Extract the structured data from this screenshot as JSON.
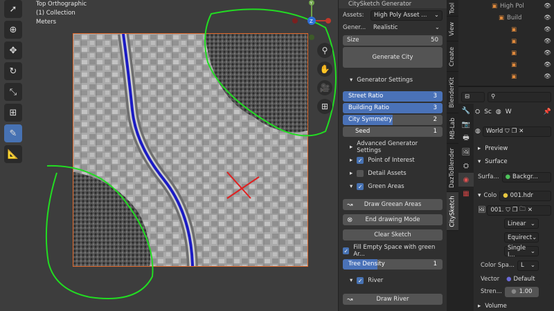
{
  "viewport": {
    "info": [
      "Top Orthographic",
      "(1) Collection",
      "Meters"
    ],
    "tools": [
      "select-box",
      "cursor",
      "move",
      "rotate",
      "scale",
      "transform",
      "annotate",
      "measure"
    ],
    "nav_tools": [
      "zoom",
      "pan",
      "camera",
      "grid"
    ]
  },
  "npanel": {
    "header": "CitySketch Generator",
    "assets_label": "Assets:",
    "assets_value": "High Poly Asset ...",
    "generator_label": "Gener...",
    "generator_value": "Realistic",
    "size_label": "Size",
    "size_value": "50",
    "generate_button": "Generate City",
    "generator_settings": "Generator Settings",
    "sliders": [
      {
        "label": "Street Ratio",
        "value": "3",
        "fill": 1.0
      },
      {
        "label": "Building Ratio",
        "value": "3",
        "fill": 1.0
      },
      {
        "label": "City Symmetry",
        "value": "2",
        "fill": 0.5
      },
      {
        "label": "Seed",
        "value": "1",
        "fill": 0.0
      }
    ],
    "advanced": "Advanced Generator Settings",
    "poi": "Point of Interest",
    "detail": "Detail Assets",
    "green": "Green Areas",
    "draw_green": "Draw Greean Areas",
    "end_drawing": "End drawing Mode",
    "clear_sketch": "Clear Sketch",
    "fill_empty": "Fill Empty Space with green Ar...",
    "tree_density_label": "Tree Density",
    "tree_density_value": "1",
    "river": "River",
    "draw_river": "Draw River"
  },
  "tabs": [
    "Tool",
    "View",
    "Create",
    "BlenderKit",
    "MB-Lab",
    "DazToBlender",
    "CitySketch"
  ],
  "outliner": {
    "rows": [
      "High Pol",
      "Build",
      "",
      "",
      "",
      "",
      ""
    ]
  },
  "props": {
    "search_placeholder": "",
    "scene_label": "Sc",
    "world_label": "W",
    "world_name": "World",
    "preview": "Preview",
    "surface": "Surface",
    "surface_label": "Surfa...",
    "surface_value": "Backgr...",
    "color_label": "Colo",
    "color_value": "001.hdr",
    "image_name": "001.",
    "linear": "Linear",
    "equirect": "Equirect",
    "single": "Single I...",
    "color_space_label": "Color Spa...",
    "color_space_value": "L",
    "vector_label": "Vector",
    "vector_value": "Default",
    "strength_label": "Stren...",
    "strength_value": "1.00",
    "volume": "Volume"
  }
}
